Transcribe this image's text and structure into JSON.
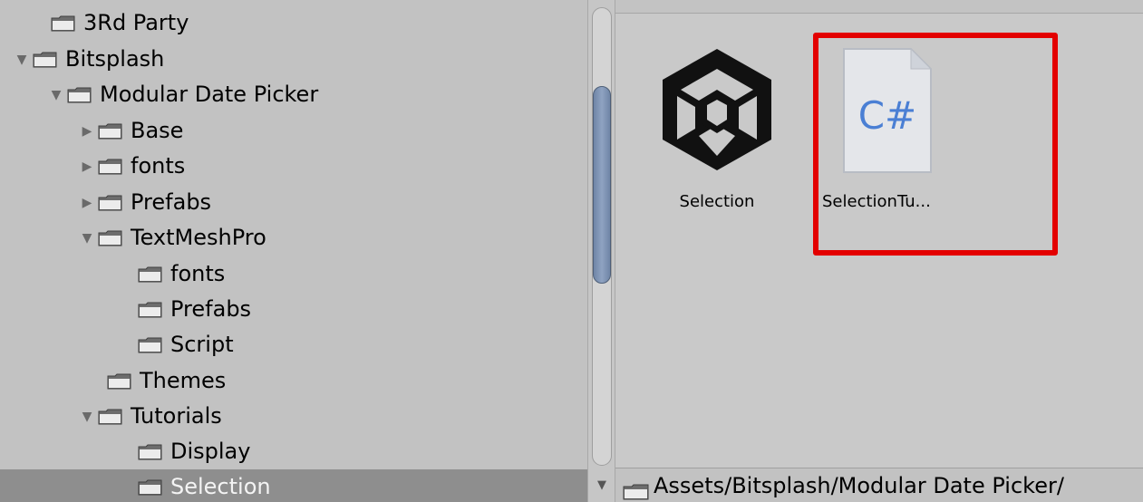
{
  "tree": {
    "items": [
      {
        "label": "3Rd Party",
        "expanded": null,
        "selected": false
      },
      {
        "label": "Bitsplash",
        "expanded": true,
        "selected": false
      },
      {
        "label": "Modular Date Picker",
        "expanded": true,
        "selected": false
      },
      {
        "label": "Base",
        "expanded": false,
        "selected": false
      },
      {
        "label": "fonts",
        "expanded": false,
        "selected": false
      },
      {
        "label": "Prefabs",
        "expanded": false,
        "selected": false
      },
      {
        "label": "TextMeshPro",
        "expanded": true,
        "selected": false
      },
      {
        "label": "fonts",
        "expanded": null,
        "selected": false
      },
      {
        "label": "Prefabs",
        "expanded": null,
        "selected": false
      },
      {
        "label": "Script",
        "expanded": null,
        "selected": false
      },
      {
        "label": "Themes",
        "expanded": null,
        "selected": false
      },
      {
        "label": "Tutorials",
        "expanded": true,
        "selected": false
      },
      {
        "label": "Display",
        "expanded": null,
        "selected": false
      },
      {
        "label": "Selection",
        "expanded": null,
        "selected": true
      }
    ]
  },
  "assets": [
    {
      "label": "Selection",
      "icon": "unity-logo-icon"
    },
    {
      "label": "SelectionTu...",
      "icon": "csharp-script-icon",
      "icon_text": "C#"
    }
  ],
  "path_bar": {
    "text": "Assets/Bitsplash/Modular Date Picker/"
  },
  "colors": {
    "highlight": "#e30000",
    "selected_row": "#8e8e8e",
    "csharp_text": "#4a7fd4"
  }
}
